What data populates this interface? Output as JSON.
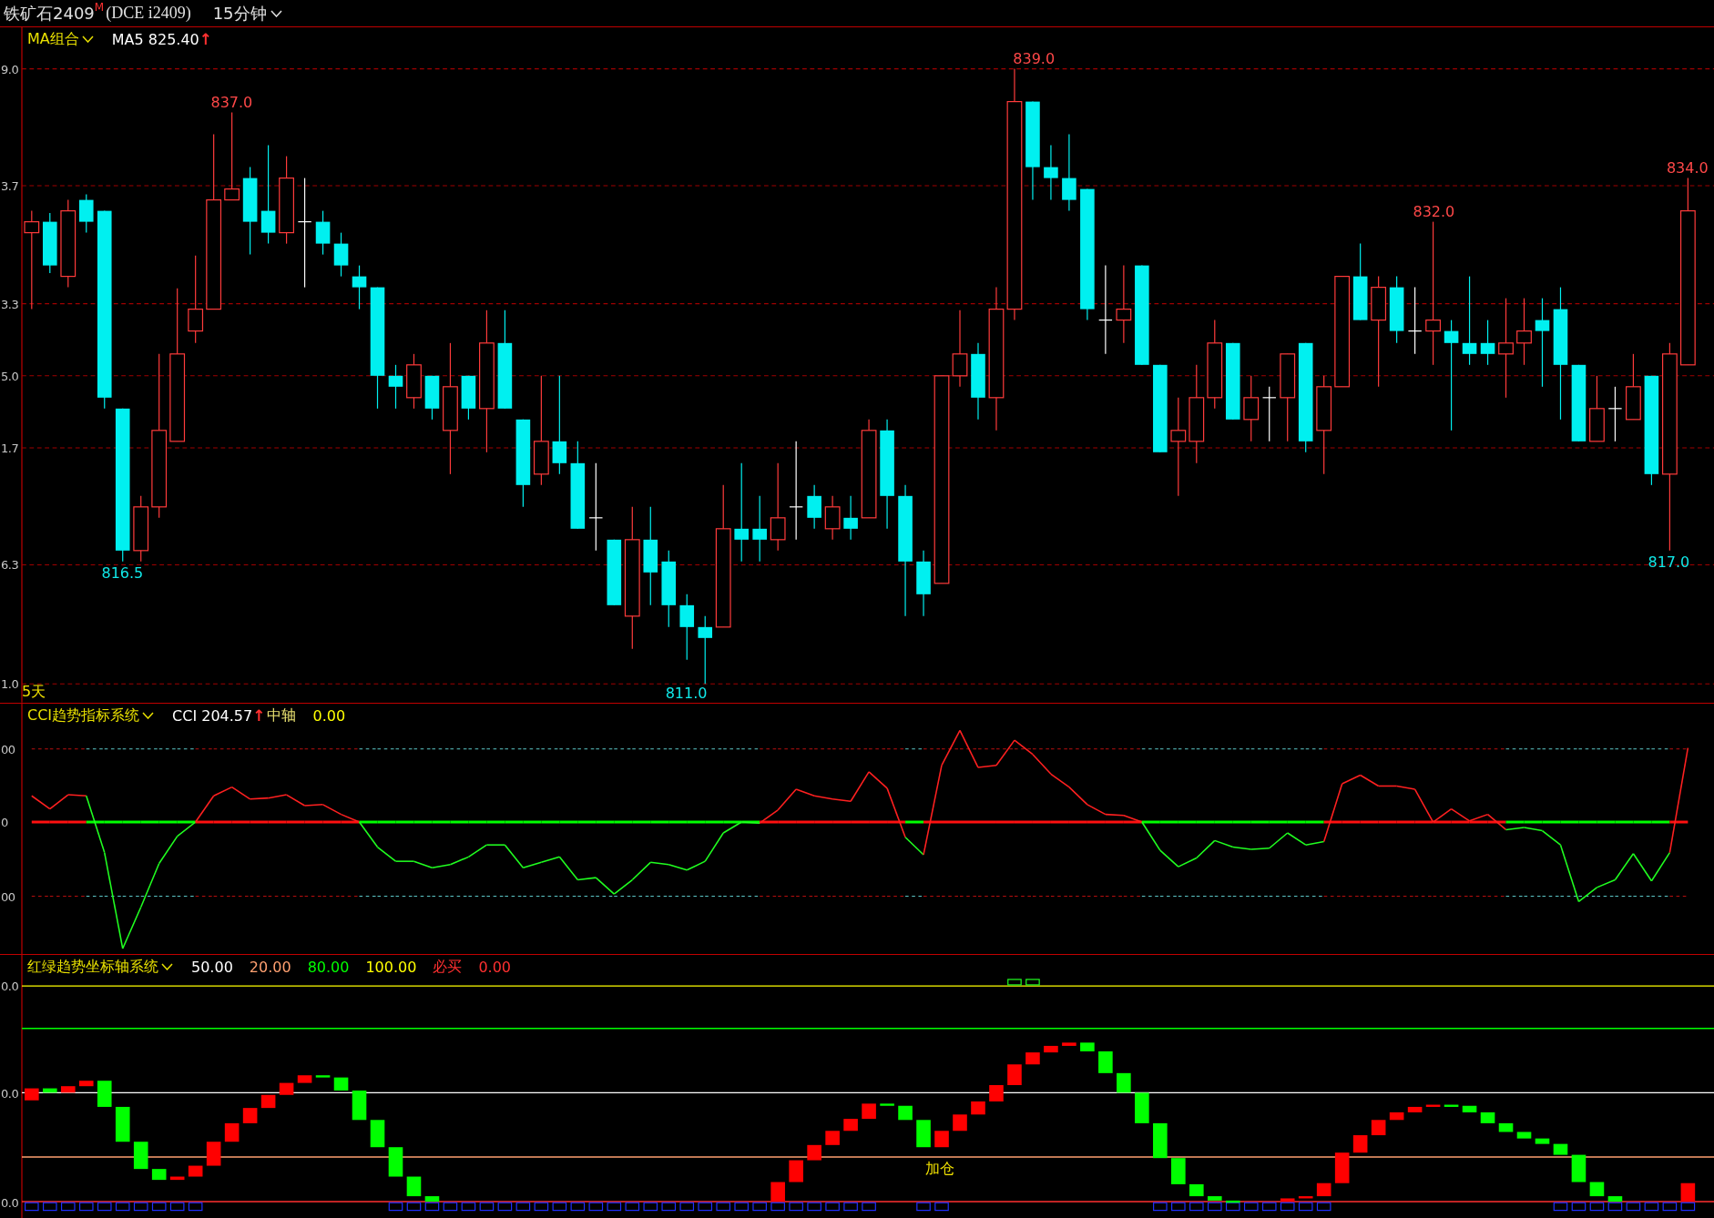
{
  "title_bar": {
    "name": "铁矿石2409",
    "badge": "M",
    "code": "(DCE i2409)",
    "period": "15分钟"
  },
  "price_panel": {
    "indicator": "MA组合",
    "readouts": [
      {
        "kind": "value",
        "text": "MA5 825.40",
        "color": "#ffffff"
      },
      {
        "kind": "arrow",
        "text": "↑",
        "color": "#ff3030"
      }
    ],
    "axis_labels": [
      "9.0",
      "3.7",
      "3.3",
      "5.0",
      "1.7",
      "6.3",
      "1.0"
    ],
    "extremes": [
      {
        "kind": "high",
        "text": "837.0"
      },
      {
        "kind": "high",
        "text": "839.0"
      },
      {
        "kind": "high",
        "text": "832.0"
      },
      {
        "kind": "high",
        "text": "834.0"
      },
      {
        "kind": "low",
        "text": "816.5"
      },
      {
        "kind": "low",
        "text": "811.0"
      },
      {
        "kind": "low",
        "text": "817.0"
      }
    ],
    "range_label": "5天"
  },
  "cci_panel": {
    "indicator": "CCI趋势指标系统",
    "readouts": [
      {
        "kind": "value",
        "text": "CCI 204.57",
        "color": "#ffffff"
      },
      {
        "kind": "arrow",
        "text": "↑",
        "color": "#ff3030"
      },
      {
        "kind": "value",
        "text": "中轴",
        "color": "#e8e070"
      },
      {
        "kind": "value",
        "text": "0.00",
        "color": "#ffff00"
      }
    ],
    "axis_labels": [
      "00",
      "0",
      "00"
    ]
  },
  "trend_panel": {
    "indicator": "红绿趋势坐标轴系统",
    "readouts": [
      {
        "kind": "value",
        "text": "50.00",
        "color": "#ffffff"
      },
      {
        "kind": "value",
        "text": "20.00",
        "color": "#ffa070"
      },
      {
        "kind": "value",
        "text": "80.00",
        "color": "#00ff00"
      },
      {
        "kind": "value",
        "text": "100.00",
        "color": "#ffff00"
      },
      {
        "kind": "value",
        "text": "必买",
        "color": "#ff3030"
      },
      {
        "kind": "value",
        "text": "0.00",
        "color": "#ff3030"
      }
    ],
    "axis_labels": [
      "0.0",
      "0.0",
      "0.0"
    ],
    "signals": [
      "加仓"
    ]
  }
}
